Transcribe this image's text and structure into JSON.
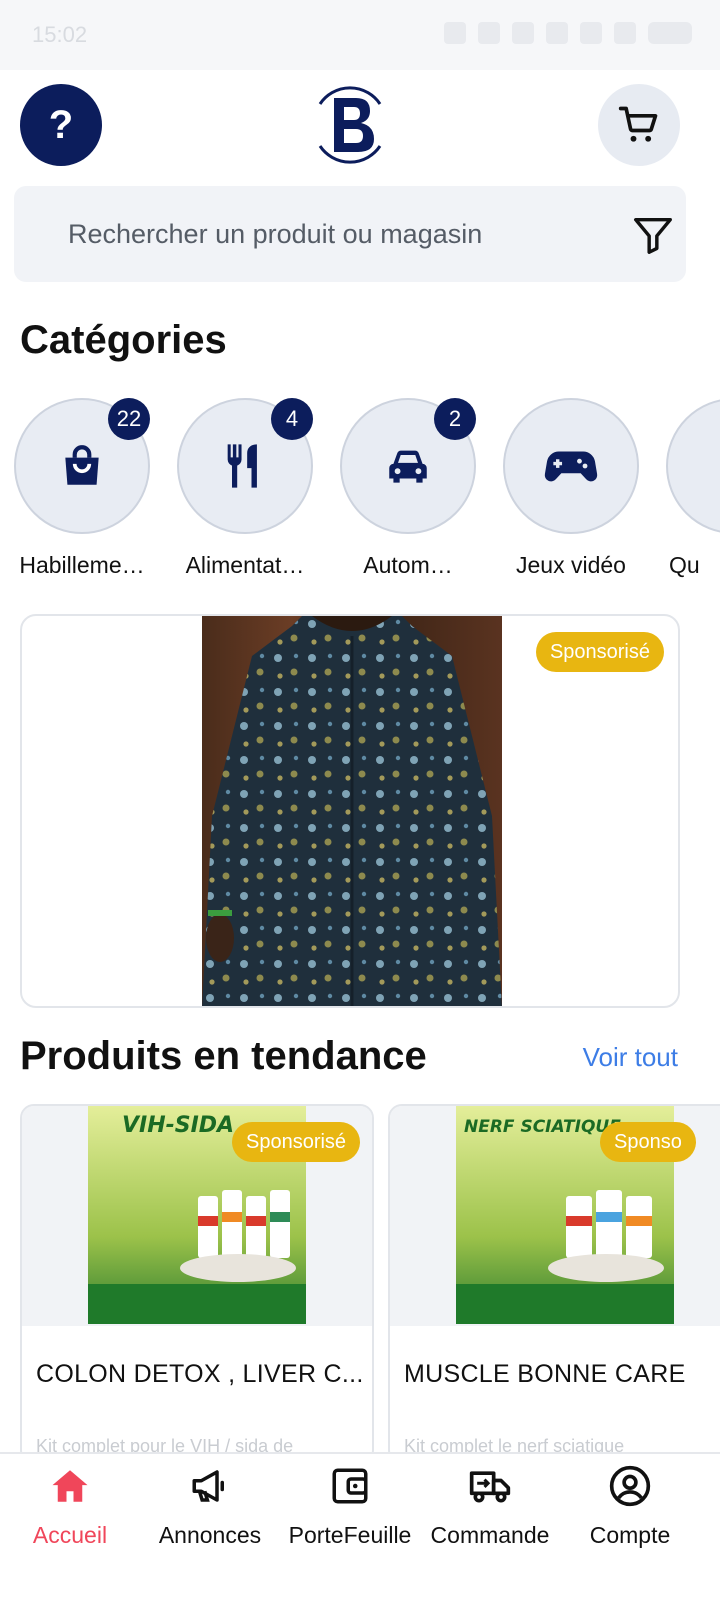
{
  "status_bar": {
    "time": "15:02"
  },
  "header": {
    "help_label": "?"
  },
  "search": {
    "placeholder": "Rechercher un produit ou magasin"
  },
  "categories": {
    "title": "Catégories",
    "items": [
      {
        "label": "Habilleme…",
        "count": "22",
        "icon": "shopping-bag-icon"
      },
      {
        "label": "Alimentat…",
        "count": "4",
        "icon": "fork-knife-icon"
      },
      {
        "label": "Autom…",
        "count": "2",
        "icon": "car-icon"
      },
      {
        "label": "Jeux vidéo",
        "count": "",
        "icon": "gamepad-icon"
      },
      {
        "label": "Qu",
        "count": "",
        "icon": ""
      }
    ]
  },
  "banner": {
    "sponsor_label": "Sponsorisé"
  },
  "trending": {
    "title": "Produits en tendance",
    "see_all": "Voir tout",
    "products": [
      {
        "image_text": "VIH-SIDA",
        "sponsor_label": "Sponsorisé",
        "name": "COLON DETOX , LIVER C...",
        "desc": "Kit complet pour le VIH / sida de"
      },
      {
        "image_text": "NERF SCIATIQUE",
        "sponsor_label": "Sponso",
        "name": "MUSCLE BONNE CARE",
        "desc": "Kit complet le nerf sciatique"
      }
    ]
  },
  "bottom_nav": {
    "items": [
      {
        "label": "Accueil",
        "icon": "home-icon",
        "active": true
      },
      {
        "label": "Annonces",
        "icon": "megaphone-icon",
        "active": false
      },
      {
        "label": "PorteFeuille",
        "icon": "wallet-icon",
        "active": false
      },
      {
        "label": "Commande",
        "icon": "truck-icon",
        "active": false
      },
      {
        "label": "Compte",
        "icon": "account-icon",
        "active": false
      }
    ]
  },
  "colors": {
    "primary": "#0c1d5c",
    "sponsor": "#e8b611",
    "link": "#3d7de6",
    "active": "#f0465a"
  }
}
